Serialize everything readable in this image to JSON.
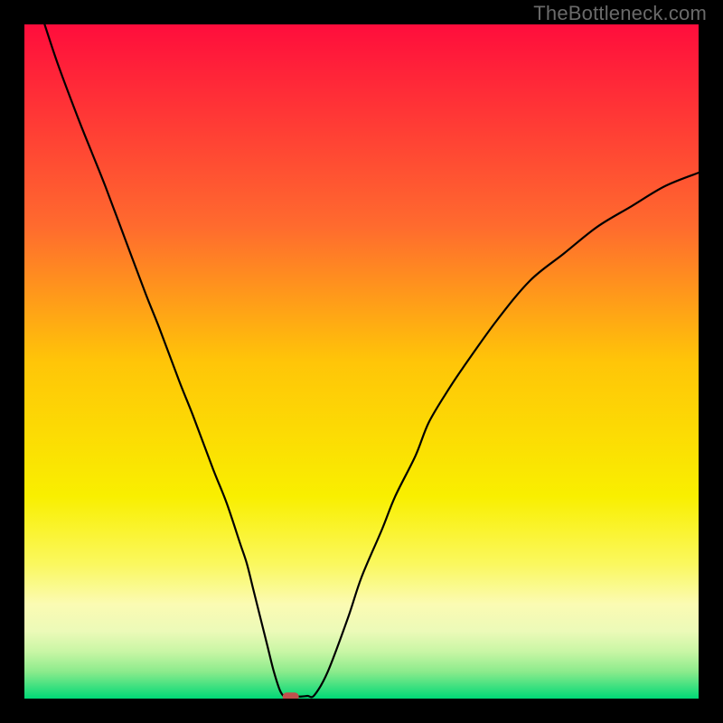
{
  "watermark": "TheBottleneck.com",
  "chart_data": {
    "type": "line",
    "title": "",
    "xlabel": "",
    "ylabel": "",
    "xlim": [
      0,
      100
    ],
    "ylim": [
      0,
      100
    ],
    "x": [
      3,
      5,
      8,
      10,
      12,
      15,
      18,
      20,
      23,
      25,
      28,
      30,
      32,
      33,
      34,
      35,
      36,
      37,
      38,
      39,
      40,
      41,
      42,
      43,
      45,
      48,
      50,
      53,
      55,
      58,
      60,
      63,
      65,
      70,
      75,
      80,
      85,
      90,
      95,
      100
    ],
    "values": [
      100,
      94,
      86,
      81,
      76,
      68,
      60,
      55,
      47,
      42,
      34,
      29,
      23,
      20,
      16,
      12,
      8,
      4,
      1,
      0,
      0.3,
      0.3,
      0.4,
      0.5,
      4,
      12,
      18,
      25,
      30,
      36,
      41,
      46,
      49,
      56,
      62,
      66,
      70,
      73,
      76,
      78
    ],
    "marker": {
      "x": 39.5,
      "y": 0.3,
      "color": "#c0504d"
    },
    "background_gradient": {
      "stops": [
        {
          "offset": 0.0,
          "color": "#ff0d3c"
        },
        {
          "offset": 0.3,
          "color": "#ff6b2e"
        },
        {
          "offset": 0.5,
          "color": "#ffc508"
        },
        {
          "offset": 0.7,
          "color": "#f9ef00"
        },
        {
          "offset": 0.8,
          "color": "#faf85e"
        },
        {
          "offset": 0.86,
          "color": "#fbfbb3"
        },
        {
          "offset": 0.9,
          "color": "#ecfab8"
        },
        {
          "offset": 0.93,
          "color": "#c9f6a5"
        },
        {
          "offset": 0.96,
          "color": "#8ceb8c"
        },
        {
          "offset": 1.0,
          "color": "#00d876"
        }
      ]
    }
  }
}
